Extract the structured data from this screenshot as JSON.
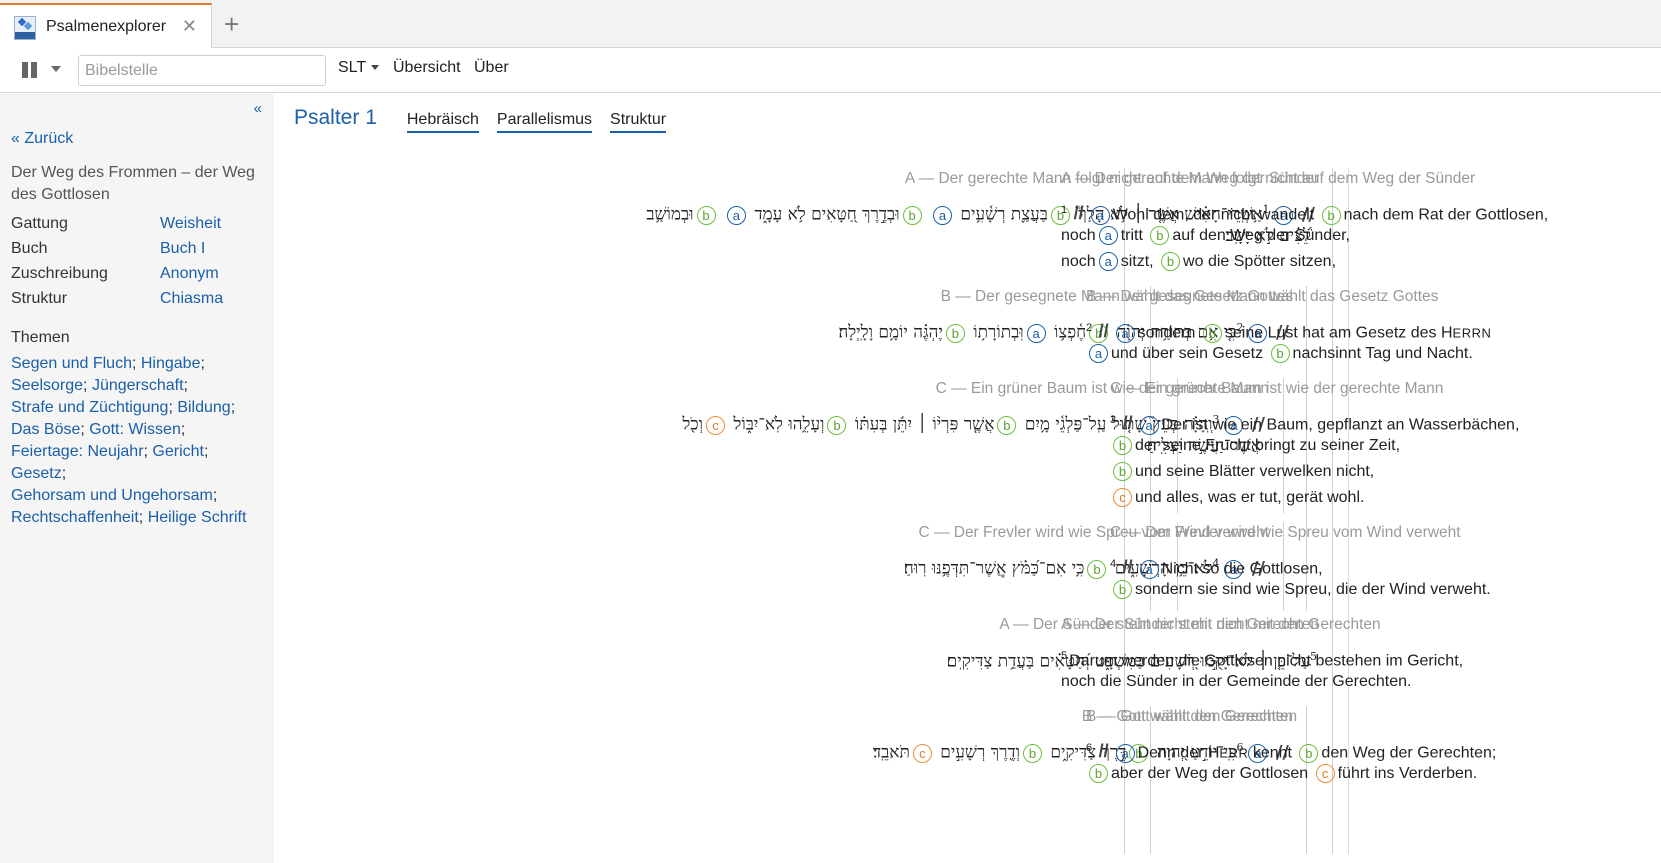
{
  "tab": {
    "title": "Psalmenexplorer",
    "close": "✕",
    "new": "+"
  },
  "toolbar": {
    "search_placeholder": "Bibelstelle",
    "translation": "SLT",
    "overview": "Übersicht",
    "about": "Über"
  },
  "sidebar": {
    "collapse": "«",
    "back": "« Zurück",
    "psalm_title": "Der Weg des Frommen – der Weg des Gottlosen",
    "meta": [
      {
        "label": "Gattung",
        "value": "Weisheit"
      },
      {
        "label": "Buch",
        "value": "Buch I"
      },
      {
        "label": "Zuschreibung",
        "value": "Anonym"
      },
      {
        "label": "Struktur",
        "value": "Chiasma"
      }
    ],
    "themes_label": "Themen",
    "themes": [
      "Segen und Fluch",
      "Hingabe",
      "Seelsorge",
      "Jüngerschaft",
      "Strafe und Züchtigung",
      "Bildung",
      "Das Böse",
      "Gott: Wissen",
      "Feiertage: Neujahr",
      "Gericht",
      "Gesetz",
      "Gehorsam und Ungehorsam",
      "Rechtschaffenheit",
      "Heilige Schrift"
    ]
  },
  "main": {
    "title": "Psalter 1",
    "view_tabs": [
      "Hebräisch",
      "Parallelismus",
      "Struktur"
    ],
    "sections": {
      "s1": "A — Der gerechte Mann folgt nicht auf dem Weg der Sünder",
      "s2": "B — Der gesegnete Mann wählt das Gesetz Gottes",
      "s3": "C — Ein grüner Baum ist wie der gerechte Mann",
      "s4": "C — Der Frevler wird wie Spreu vom Wind verweht",
      "s5": "A — Der Sünder steht nicht mit den Gerechten",
      "s6": "B — Gott wählt den Gerechten"
    },
    "markers": {
      "a": "a",
      "b": "b",
      "c": "c",
      "sep": "//"
    },
    "hebrew": {
      "v1_n": "1",
      "v1_p1": "אַ֥שְֽׁרֵי־הָאִ֗ישׁ אֲשֶׁ֤ר ׀ לֹ֥א הָלַךְ֮",
      "v1_p2": "בַּעֲצַ֪ת רְשָׁ֫עִ֥ים",
      "v1_p3": "וּבְדֶ֣רֶךְ חַ֭טָּאִים לֹ֥א עָמָ֑ד",
      "v1_p4": "וּבְמוֹשַׁ֥ב",
      "v1_l2": "לֵ֝צִ֗ים לֹ֣א יָשָֽׁב׃",
      "v2_n": "2",
      "v2_p1": "כִּ֤י אִ֥ם בְּתוֹרַ֥ת יְהוָ֗ה",
      "v2_p2": "חֶ֫פְצ֥וֹ",
      "v2_p3": "וּֽבְתוֹרָת֥וֹ",
      "v2_p4": "יֶהְגֶּ֗ה יוֹמָ֥ם וָלָֽיְלָה׃",
      "v3_n": "3",
      "v3_p1": "וְֽהָיָ֗ה כְּעֵץ֮ שָׁת֤וּל עַֽל־פַּלְגֵ֫י מָ֥יִם",
      "v3_p2": "אֲשֶׁ֤ר פִּרְי֨וֹ ׀ יִתֵּ֬ן בְּעִתּ֗וֹ",
      "v3_p3": "וְעָלֵ֥הוּ לֹֽא־יִבּ֑וֹל",
      "v3_p4": "וְכֹ֖ל",
      "v3_l2": "אֲשֶׁר־יַעֲשֶׂ֣ה יַצְלִֽיחַ׃",
      "v4_n": "4",
      "v4_p1": "לֹא־כֵ֥ן הָרְשָׁעִ֑ים",
      "v4_p2": "כִּ֥י אִם־כַּ֝מֹּ֗ץ אֲֽשֶׁר־תִּדְּפֶ֥נּוּ רֽוּחַ׃",
      "v5_n": "5",
      "v5_l1": "עַל־כֵּ֤ן ׀ לֹא־יָקֻ֣מוּ רְ֭שָׁעִים בַּמִּשְׁפָּ֑ט וְ֝חַטָּאִ֗ים בַּעֲדַ֥ת צַדִּיקִֽים׃",
      "v6_n": "6",
      "v6_p1": "כִּֽי־יוֹדֵ֣עַ יְ֭הוָה",
      "v6_p2": "דֶּ֣רֶךְ צַדִּיקִ֑ים",
      "v6_p3": "וְדֶ֖רֶךְ רְשָׁעִ֣ים",
      "v6_p4": "תֹּאבֵֽד׃"
    },
    "german": {
      "v1_n": "1",
      "v1_p1": "Wohl dem, der nicht wandelt",
      "v1_p2": "nach dem Rat der Gottlosen,",
      "v1_l2a": "noch",
      "v1_l2b": "tritt",
      "v1_l2c": "auf den Weg der Sünder,",
      "v1_l3a": "noch",
      "v1_l3b": "sitzt,",
      "v1_l3c": "wo die Spötter sitzen,",
      "v2_n": "2",
      "v2_p1": "sondern",
      "v2_p2a": "seine Lust hat am Gesetz des H",
      "v2_p2b": "ERRN",
      "v2_l2a": "und über sein Gesetz",
      "v2_l2b": "nachsinnt Tag und Nacht.",
      "v3_n": "3",
      "v3_p1": "Der ist wie ein Baum, gepflanzt an Wasserbächen,",
      "v3_l2": "der seine Frucht bringt zu seiner Zeit,",
      "v3_l3": "und seine Blätter verwelken nicht,",
      "v3_l4": "und alles, was er tut, gerät wohl.",
      "v4_n": "4",
      "v4_p1": "Nicht so die Gottlosen,",
      "v4_l2": "sondern sie sind wie Spreu, die der Wind verweht.",
      "v5_n": "5",
      "v5_l1": "Darum werden die Gottlosen nicht bestehen im Gericht,",
      "v5_l2": "noch die Sünder in der Gemeinde der Gerechten.",
      "v6_n": "6",
      "v6_p1a": "Denn der H",
      "v6_p1b": "ERR",
      "v6_p1c": " kennt",
      "v6_p2": "den Weg der Gerechten;",
      "v6_l2a": "aber der Weg der Gottlosen",
      "v6_l2b": "führt ins Verderben."
    }
  }
}
